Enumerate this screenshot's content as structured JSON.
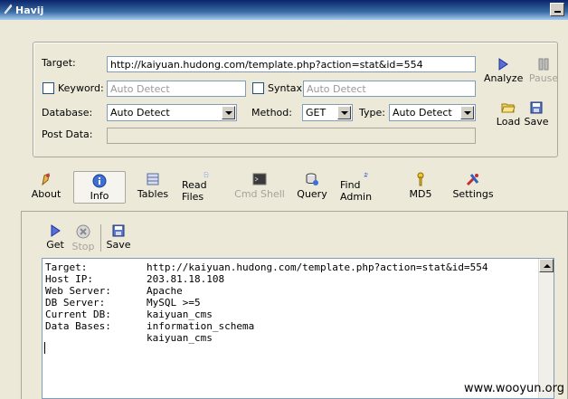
{
  "window": {
    "title": "Havij",
    "app_icon": "feather-icon"
  },
  "target_form": {
    "target_label": "Target:",
    "target_value": "http://kaiyuan.hudong.com/template.php?action=stat&id=554",
    "keyword_label": "Keyword:",
    "keyword_placeholder": "Auto Detect",
    "syntax_label": "Syntax:",
    "syntax_placeholder": "Auto Detect",
    "database_label": "Database:",
    "database_value": "Auto Detect",
    "method_label": "Method:",
    "method_value": "GET",
    "type_label": "Type:",
    "type_value": "Auto Detect",
    "postdata_label": "Post Data:",
    "postdata_value": ""
  },
  "side_buttons": {
    "analyze": "Analyze",
    "pause": "Pause",
    "load": "Load",
    "save": "Save"
  },
  "toolbar": [
    {
      "label": "About",
      "icon": "about-icon"
    },
    {
      "label": "Info",
      "icon": "info-icon"
    },
    {
      "label": "Tables",
      "icon": "tables-icon"
    },
    {
      "label": "Read Files",
      "icon": "read-files-icon"
    },
    {
      "label": "Cmd Shell",
      "icon": "cmd-shell-icon"
    },
    {
      "label": "Query",
      "icon": "query-icon"
    },
    {
      "label": "Find Admin",
      "icon": "find-admin-icon"
    },
    {
      "label": "MD5",
      "icon": "md5-key-icon"
    },
    {
      "label": "Settings",
      "icon": "settings-icon"
    }
  ],
  "info_panel": {
    "buttons": {
      "get": "Get",
      "stop": "Stop",
      "save": "Save"
    },
    "rows": [
      {
        "key": "Target:",
        "value": "http://kaiyuan.hudong.com/template.php?action=stat&id=554"
      },
      {
        "key": "Host IP:",
        "value": "203.81.18.108"
      },
      {
        "key": "Web Server:",
        "value": "Apache"
      },
      {
        "key": "DB Server:",
        "value": "MySQL >=5"
      },
      {
        "key": "Current DB:",
        "value": "kaiyuan_cms"
      },
      {
        "key": "Data Bases:",
        "value": "information_schema"
      },
      {
        "key": "",
        "value": "kaiyuan_cms"
      }
    ]
  },
  "watermark": "www.wooyun.org",
  "colors": {
    "title_bar": "#0a246a",
    "window_bg": "#ece9d8",
    "input_border": "#7f9db9"
  }
}
